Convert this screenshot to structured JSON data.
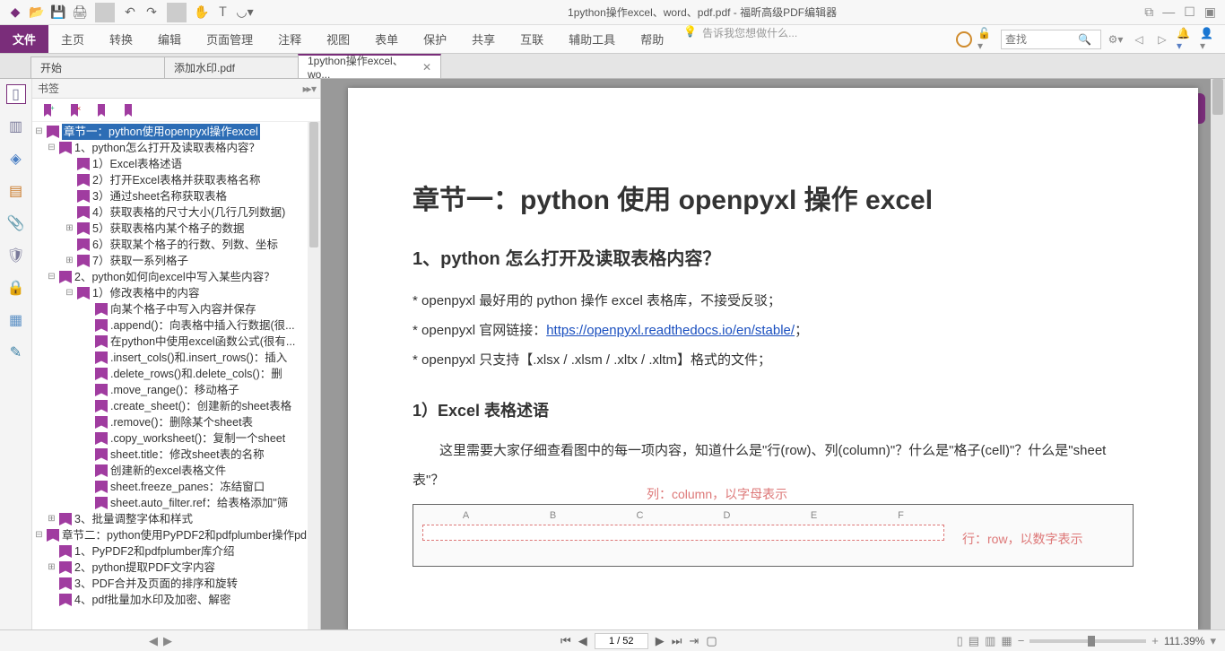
{
  "window": {
    "title": "1python操作excel、word、pdf.pdf - 福昕高级PDF编辑器"
  },
  "ribbon": {
    "file": "文件",
    "tabs": [
      "主页",
      "转换",
      "编辑",
      "页面管理",
      "注释",
      "视图",
      "表单",
      "保护",
      "共享",
      "互联",
      "辅助工具",
      "帮助"
    ],
    "tell_me_placeholder": "告诉我您想做什么...",
    "search_placeholder": "查找"
  },
  "doc_tabs": [
    {
      "label": "开始",
      "closable": false
    },
    {
      "label": "添加水印.pdf",
      "closable": false
    },
    {
      "label": "1python操作excel、wo...",
      "closable": true,
      "active": true
    }
  ],
  "panel": {
    "title": "书签"
  },
  "bookmarks": [
    {
      "lvl": 0,
      "tw": "⊟",
      "sel": true,
      "txt": "章节一：python使用openpyxl操作excel"
    },
    {
      "lvl": 1,
      "tw": "⊟",
      "txt": "1、python怎么打开及读取表格内容？"
    },
    {
      "lvl": 2,
      "tw": "",
      "txt": "1）Excel表格述语"
    },
    {
      "lvl": 2,
      "tw": "",
      "txt": "2）打开Excel表格并获取表格名称"
    },
    {
      "lvl": 2,
      "tw": "",
      "txt": "3）通过sheet名称获取表格"
    },
    {
      "lvl": 2,
      "tw": "",
      "txt": "4）获取表格的尺寸大小(几行几列数据)"
    },
    {
      "lvl": 2,
      "tw": "⊞",
      "txt": "5）获取表格内某个格子的数据"
    },
    {
      "lvl": 2,
      "tw": "",
      "txt": "6）获取某个格子的行数、列数、坐标"
    },
    {
      "lvl": 2,
      "tw": "⊞",
      "txt": "7）获取一系列格子"
    },
    {
      "lvl": 1,
      "tw": "⊟",
      "txt": "2、python如何向excel中写入某些内容？"
    },
    {
      "lvl": 2,
      "tw": "⊟",
      "txt": "1）修改表格中的内容"
    },
    {
      "lvl": 3,
      "tw": "",
      "txt": "向某个格子中写入内容并保存"
    },
    {
      "lvl": 3,
      "tw": "",
      "txt": ".append()：向表格中插入行数据(很..."
    },
    {
      "lvl": 3,
      "tw": "",
      "txt": "在python中使用excel函数公式(很有..."
    },
    {
      "lvl": 3,
      "tw": "",
      "txt": ".insert_cols()和.insert_rows()：插入"
    },
    {
      "lvl": 3,
      "tw": "",
      "txt": ".delete_rows()和.delete_cols()：删"
    },
    {
      "lvl": 3,
      "tw": "",
      "txt": ".move_range()：移动格子"
    },
    {
      "lvl": 3,
      "tw": "",
      "txt": ".create_sheet()：创建新的sheet表格"
    },
    {
      "lvl": 3,
      "tw": "",
      "txt": ".remove()：删除某个sheet表"
    },
    {
      "lvl": 3,
      "tw": "",
      "txt": ".copy_worksheet()：复制一个sheet"
    },
    {
      "lvl": 3,
      "tw": "",
      "txt": "sheet.title：修改sheet表的名称"
    },
    {
      "lvl": 3,
      "tw": "",
      "txt": "创建新的excel表格文件"
    },
    {
      "lvl": 3,
      "tw": "",
      "txt": "sheet.freeze_panes：冻结窗口"
    },
    {
      "lvl": 3,
      "tw": "",
      "txt": "sheet.auto_filter.ref：给表格添加\"筛"
    },
    {
      "lvl": 1,
      "tw": "⊞",
      "txt": "3、批量调整字体和样式"
    },
    {
      "lvl": 0,
      "tw": "⊟",
      "txt": "章节二：python使用PyPDF2和pdfplumber操作pd"
    },
    {
      "lvl": 1,
      "tw": "",
      "txt": "1、PyPDF2和pdfplumber库介绍"
    },
    {
      "lvl": 1,
      "tw": "⊞",
      "txt": "2、python提取PDF文字内容"
    },
    {
      "lvl": 1,
      "tw": "",
      "txt": "3、PDF合并及页面的排序和旋转"
    },
    {
      "lvl": 1,
      "tw": "",
      "txt": "4、pdf批量加水印及加密、解密"
    }
  ],
  "document": {
    "h1": "章节一：python 使用 openpyxl 操作 excel",
    "h2": "1、python 怎么打开及读取表格内容？",
    "p1_pre": "* openpyxl 最好用的 python 操作 excel 表格库，不接受反驳；",
    "p2_pre": "* openpyxl 官网链接：",
    "p2_link": "https://openpyxl.readthedocs.io/en/stable/",
    "p2_suf": "；",
    "p3": "* openpyxl 只支持【.xlsx / .xlsm / .xltx / .xltm】格式的文件；",
    "h3": "1）Excel 表格述语",
    "p4": "这里需要大家仔细查看图中的每一项内容，知道什么是\"行(row)、列(column)\"？什么是\"格子(cell)\"？什么是\"sheet 表\"？",
    "col_label": "列：column，以字母表示",
    "row_label": "行：row，以数字表示"
  },
  "status": {
    "page": "1 / 52",
    "zoom": "111.39%"
  }
}
